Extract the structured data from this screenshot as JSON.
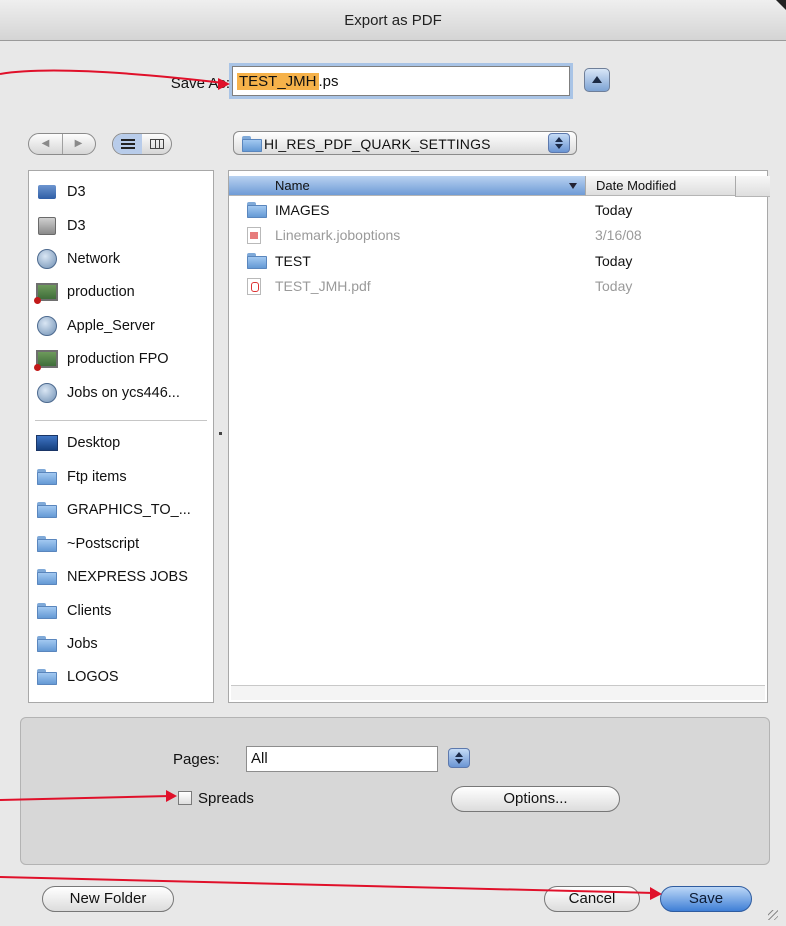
{
  "window": {
    "title": "Export as PDF"
  },
  "save_as": {
    "label": "Save As:",
    "selected_part": "TEST_JMH",
    "rest": ".ps"
  },
  "nav": {
    "back_glyph": "◀",
    "forward_glyph": "▶"
  },
  "location": {
    "label": "HI_RES_PDF_QUARK_SETTINGS"
  },
  "sidebar": {
    "devices": [
      {
        "label": "D3",
        "icon": "disk-icon"
      },
      {
        "label": "D3",
        "icon": "drive-icon"
      },
      {
        "label": "Network",
        "icon": "network-globe-icon"
      },
      {
        "label": "production",
        "icon": "server-screen-icon"
      },
      {
        "label": "Apple_Server",
        "icon": "network-globe-icon"
      },
      {
        "label": "production FPO",
        "icon": "server-screen-icon"
      },
      {
        "label": "Jobs on ycs446...",
        "icon": "network-globe-icon"
      }
    ],
    "places": [
      {
        "label": "Desktop",
        "icon": "desktop-icon"
      },
      {
        "label": "Ftp items",
        "icon": "folder-icon"
      },
      {
        "label": "GRAPHICS_TO_...",
        "icon": "folder-icon"
      },
      {
        "label": "~Postscript",
        "icon": "folder-icon"
      },
      {
        "label": "NEXPRESS JOBS",
        "icon": "folder-icon"
      },
      {
        "label": "Clients",
        "icon": "folder-icon"
      },
      {
        "label": "Jobs",
        "icon": "folder-icon"
      },
      {
        "label": "LOGOS",
        "icon": "folder-icon"
      }
    ]
  },
  "files": {
    "columns": {
      "name": "Name",
      "date": "Date Modified"
    },
    "rows": [
      {
        "name": "IMAGES",
        "date": "Today",
        "icon": "folder-icon",
        "dimmed": false
      },
      {
        "name": "Linemark.joboptions",
        "date": "3/16/08",
        "icon": "document-icon",
        "dimmed": true
      },
      {
        "name": "TEST",
        "date": "Today",
        "icon": "folder-icon",
        "dimmed": false
      },
      {
        "name": "TEST_JMH.pdf",
        "date": "Today",
        "icon": "pdf-document-icon",
        "dimmed": true
      }
    ]
  },
  "options": {
    "pages_label": "Pages:",
    "pages_value": "All",
    "spreads_label": "Spreads",
    "spreads_checked": false,
    "options_button": "Options..."
  },
  "buttons": {
    "new_folder": "New Folder",
    "cancel": "Cancel",
    "save": "Save"
  },
  "colors": {
    "accent": "#3f7fd6",
    "selection": "#f6b24a",
    "annotation_arrow": "#e0102a"
  }
}
